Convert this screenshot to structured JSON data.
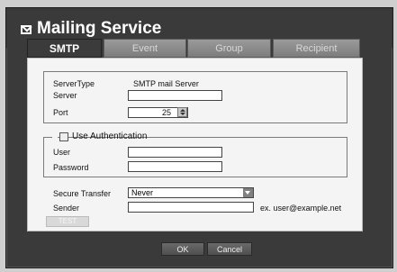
{
  "window": {
    "title": "Mailing Service"
  },
  "tabs": [
    "SMTP",
    "Event",
    "Group",
    "Recipient"
  ],
  "smtp": {
    "server_type_label": "ServerType",
    "server_type_value": "SMTP mail Server",
    "server_label": "Server",
    "server_value": "",
    "port_label": "Port",
    "port_value": "25"
  },
  "auth": {
    "label": "Use Authentication",
    "checked": false,
    "user_label": "User",
    "user_value": "",
    "password_label": "Password",
    "password_value": ""
  },
  "transfer": {
    "secure_label": "Secure Transfer",
    "secure_value": "Never",
    "sender_label": "Sender",
    "sender_value": "",
    "sender_hint": "ex. user@example.net",
    "test_label": "TEST"
  },
  "footer": {
    "ok_label": "OK",
    "cancel_label": "Cancel"
  }
}
